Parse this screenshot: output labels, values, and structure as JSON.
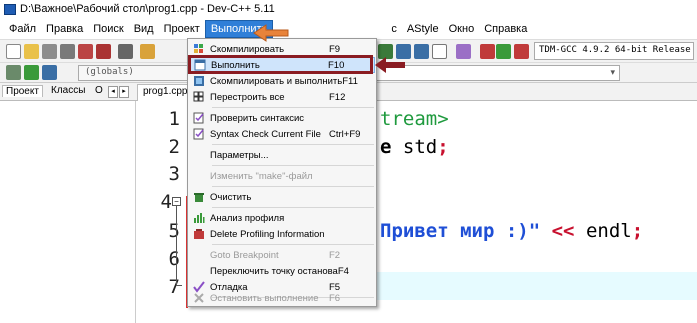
{
  "window": {
    "title": "D:\\Важное\\Рабочий стол\\prog1.cpp - Dev-C++ 5.11",
    "icon": "devcpp-app-icon"
  },
  "menubar": {
    "items": [
      {
        "label": "Файл"
      },
      {
        "label": "Правка"
      },
      {
        "label": "Поиск"
      },
      {
        "label": "Вид"
      },
      {
        "label": "Проект"
      },
      {
        "label": "Выполнить",
        "active": true
      },
      {
        "label": "Сервис"
      },
      {
        "label": "AStyle"
      },
      {
        "label": "Окно"
      },
      {
        "label": "Справка"
      }
    ],
    "partial_label": "с"
  },
  "toolbar": {
    "compiler": "TDM-GCC 4.9.2 64-bit Release"
  },
  "toolbar2": {
    "globals": "(globals)"
  },
  "left_tabs": {
    "project": "Проект",
    "classes": "Классы",
    "debug": "О",
    "prev": "◂",
    "next": "▸"
  },
  "file_tab": "prog1.cpp",
  "run_menu": {
    "items": [
      {
        "label": "Скомпилировать",
        "shortcut": "F9",
        "icon": "compile-icon"
      },
      {
        "label": "Выполнить",
        "shortcut": "F10",
        "icon": "run-icon",
        "highlighted": true
      },
      {
        "label": "Скомпилировать и выполнить",
        "shortcut": "F11",
        "icon": "compile-run-icon"
      },
      {
        "label": "Перестроить все",
        "shortcut": "F12",
        "icon": "rebuild-icon"
      },
      {
        "label": "Проверить синтаксис",
        "shortcut": "",
        "icon": "syntax-check-icon"
      },
      {
        "label": "Syntax Check Current File",
        "shortcut": "Ctrl+F9",
        "icon": "syntax-check-file-icon"
      },
      {
        "label": "Параметры...",
        "shortcut": "",
        "icon": ""
      },
      {
        "label": "Изменить \"make\"-файл",
        "shortcut": "",
        "icon": "",
        "disabled": true
      },
      {
        "label": "Очистить",
        "shortcut": "",
        "icon": "clean-icon"
      },
      {
        "label": "Анализ профиля",
        "shortcut": "",
        "icon": "profile-icon"
      },
      {
        "label": "Delete Profiling Information",
        "shortcut": "",
        "icon": "delete-profile-icon"
      },
      {
        "label": "Goto Breakpoint",
        "shortcut": "F2",
        "icon": "",
        "disabled": true
      },
      {
        "label": "Переключить точку останова",
        "shortcut": "F4",
        "icon": ""
      },
      {
        "label": "Отладка",
        "shortcut": "F5",
        "icon": "debug-check-icon"
      },
      {
        "label": "Остановить выполнение",
        "shortcut": "F6",
        "icon": "stop-icon",
        "disabled": true
      }
    ]
  },
  "editor": {
    "line_numbers": [
      "1",
      "2",
      "3",
      "4",
      "5",
      "6",
      "7"
    ],
    "fold_marker": "−",
    "line1": "tream>",
    "line2_kw": "e",
    "line2_rest": " std",
    "line2_end": ";",
    "line5_str": "Привет мир :)\"",
    "line5_op": "<<",
    "line5_id": " endl",
    "line5_end": ";"
  },
  "colors": {
    "menu_active": "#2f7fd8",
    "annotation_arrow": "#e8833a",
    "selection_frame": "#8a1c22",
    "current_line": "#e6fbff"
  }
}
